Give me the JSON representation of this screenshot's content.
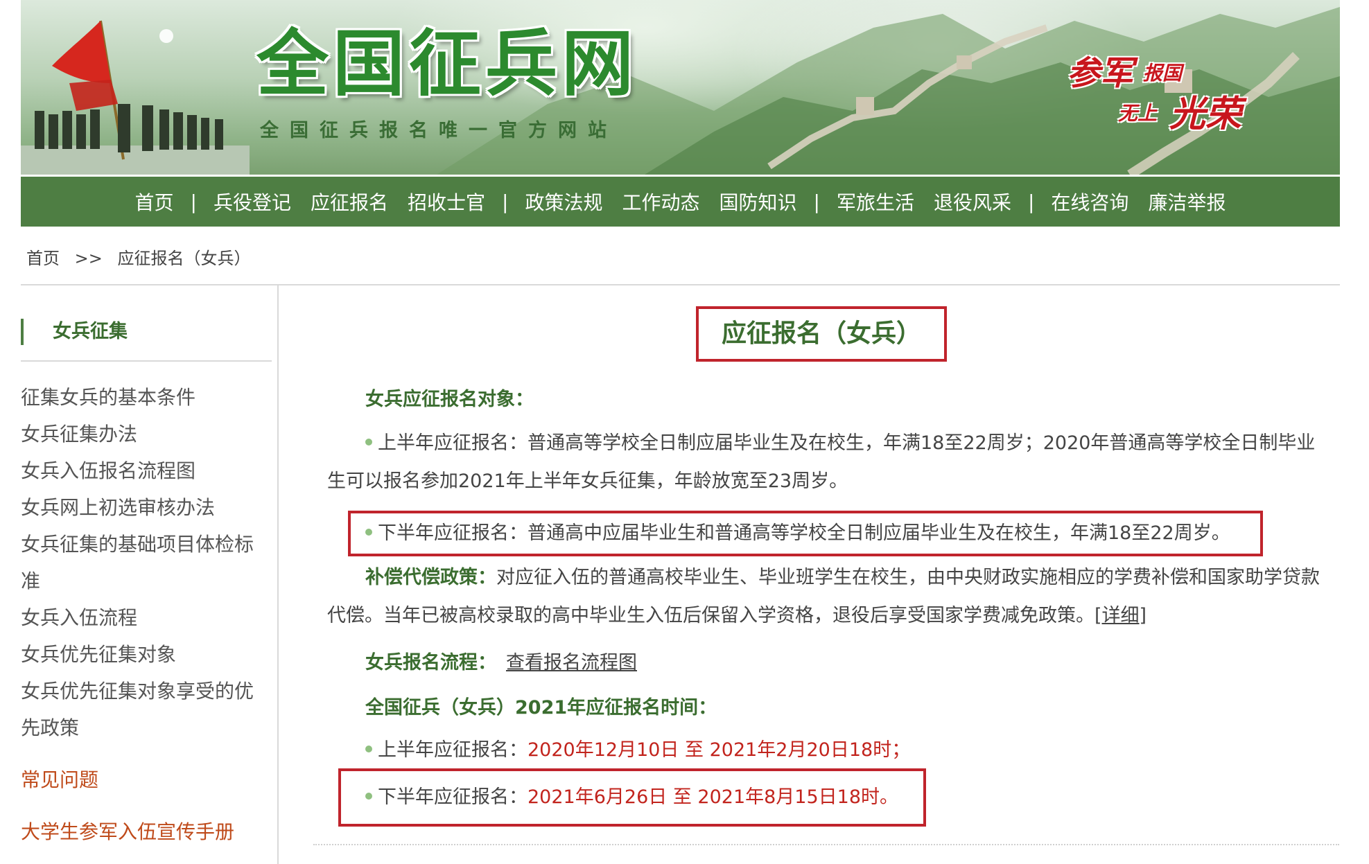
{
  "header": {
    "site_title": "全国征兵网",
    "site_subtitle": "全国征兵报名唯一官方网站",
    "slogan": {
      "part1": "参军",
      "part2": "报国",
      "part3": "无上",
      "part4": "光荣"
    }
  },
  "nav": {
    "items": [
      {
        "label": "首页"
      },
      {
        "label": "兵役登记"
      },
      {
        "label": "应征报名"
      },
      {
        "label": "招收士官"
      },
      {
        "label": "政策法规"
      },
      {
        "label": "工作动态"
      },
      {
        "label": "国防知识"
      },
      {
        "label": "军旅生活"
      },
      {
        "label": "退役风采"
      },
      {
        "label": "在线咨询"
      },
      {
        "label": "廉洁举报"
      }
    ],
    "separator": "|"
  },
  "breadcrumb": {
    "home": "首页",
    "sep": ">>",
    "current": "应征报名（女兵）"
  },
  "sidebar": {
    "title": "女兵征集",
    "items": [
      {
        "label": "征集女兵的基本条件"
      },
      {
        "label": "女兵征集办法"
      },
      {
        "label": "女兵入伍报名流程图"
      },
      {
        "label": "女兵网上初选审核办法"
      },
      {
        "label": "女兵征集的基础项目体检标准"
      },
      {
        "label": "女兵入伍流程"
      },
      {
        "label": "女兵优先征集对象"
      },
      {
        "label": "女兵优先征集对象享受的优先政策"
      }
    ],
    "faq": "常见问题",
    "handbook": "大学生参军入伍宣传手册"
  },
  "content": {
    "page_title": "应征报名（女兵）",
    "targets_heading": "女兵应征报名对象：",
    "first_half_label": "上半年应征报名：",
    "first_half_text": "普通高等学校全日制应届毕业生及在校生，年满18至22周岁；2020年普通高等学校全日制毕业生可以报名参加2021年上半年女兵征集，年龄放宽至23周岁。",
    "second_half_label": "下半年应征报名：",
    "second_half_text": "普通高中应届毕业生和普通高等学校全日制应届毕业生及在校生，年满18至22周岁。",
    "compensation_heading": "补偿代偿政策：",
    "compensation_text": "对应征入伍的普通高校毕业生、毕业班学生在校生，由中央财政实施相应的学费补偿和国家助学贷款代偿。当年已被高校录取的高中毕业生入伍后保留入学资格，退役后享受国家学费减免政策。",
    "compensation_link": "[详细]",
    "process_heading": "女兵报名流程：",
    "process_link": "查看报名流程图",
    "time_heading": "全国征兵（女兵）2021年应征报名时间：",
    "time_first_label": "上半年应征报名：",
    "time_first_value": "2020年12月10日 至 2021年2月20日18时；",
    "time_second_label": "下半年应征报名：",
    "time_second_value": "2021年6月26日 至 2021年8月15日18时。"
  },
  "colors": {
    "nav_green": "#4e7e43",
    "heading_green": "#3b6d30",
    "highlight_red": "#c0242c",
    "date_red": "#c2241d",
    "sidebar_orange": "#bf4a1a"
  }
}
